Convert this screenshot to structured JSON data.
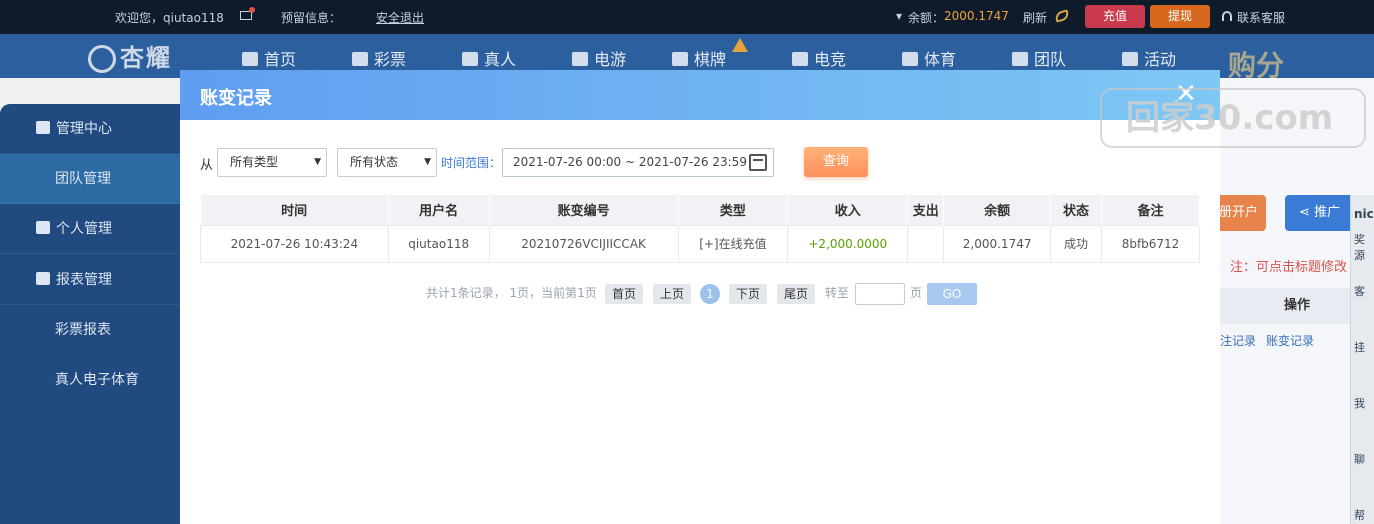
{
  "topbar": {
    "welcome": "欢迎您，qiutao118",
    "reserved_info": "预留信息：",
    "logout": "安全退出",
    "balance_label": "余额：",
    "balance_value": "2000.1747",
    "refresh": "刷新",
    "recharge": "充值",
    "withdraw": "提现",
    "support": "联系客服"
  },
  "nav": {
    "logo": "杏耀",
    "items": [
      "首页",
      "彩票",
      "真人",
      "电游",
      "棋牌",
      "电竞",
      "体育",
      "团队",
      "活动"
    ],
    "extra": "购分"
  },
  "sidebar": {
    "items": [
      "管理中心",
      "团队管理",
      "个人管理",
      "报表管理",
      "彩票报表",
      "真人电子体育"
    ]
  },
  "background_page": {
    "open_account": "册开户",
    "promote": "推广",
    "note": "注：可点击标题修改",
    "ops_header": "操作",
    "op_links": [
      "注记录",
      "账变记录"
    ],
    "float_panel": [
      "nic",
      "奖源",
      "客",
      "挂",
      "我",
      "聊",
      "帮"
    ]
  },
  "watermark": {
    "text": "回家30.com"
  },
  "modal": {
    "title": "账变记录",
    "filters": {
      "from_label": "从",
      "type_select": "所有类型",
      "status_select": "所有状态",
      "time_range_label": "时间范围：",
      "date_range": "2021-07-26 00:00 ~ 2021-07-26 23:59",
      "query_button": "查询"
    },
    "table": {
      "headers": [
        "时间",
        "用户名",
        "账变编号",
        "类型",
        "收入",
        "支出",
        "余额",
        "状态",
        "备注"
      ],
      "rows": [
        [
          "2021-07-26 10:43:24",
          "qiutao118",
          "20210726VCIJIICCAK",
          "[+]在线充值",
          "+2,000.0000",
          "",
          "2,000.1747",
          "成功",
          "8bfb6712"
        ]
      ]
    },
    "pagination": {
      "summary": "共计1条记录， 1页，当前第1页",
      "first": "首页",
      "prev": "上页",
      "current": "1",
      "next": "下页",
      "last": "尾页",
      "goto_label": "转至",
      "page_unit": "页",
      "go": "GO"
    }
  }
}
